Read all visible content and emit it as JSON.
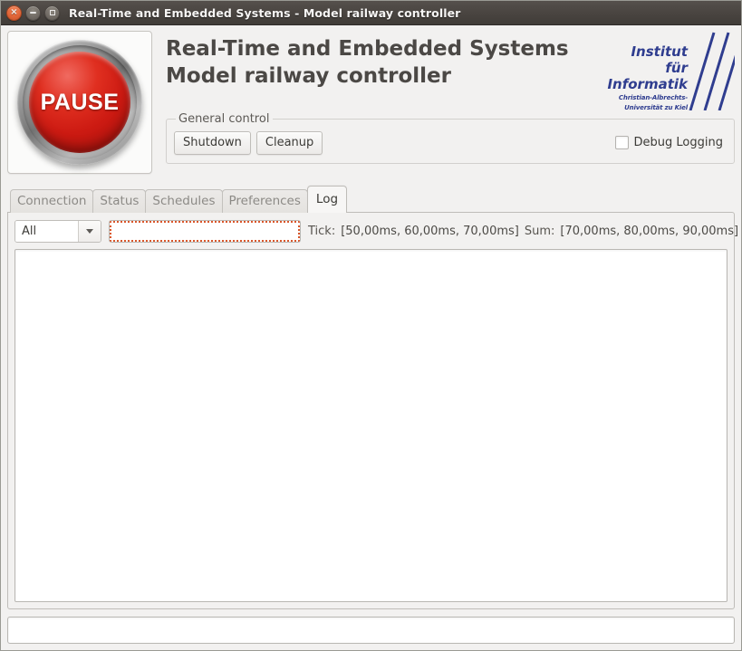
{
  "window": {
    "title": "Real-Time and Embedded Systems - Model railway controller",
    "buttons": {
      "close": "close-button",
      "minimize": "minimize-button",
      "maximize": "maximize-button",
      "close_glyph": "×"
    }
  },
  "header": {
    "pause_button_label": "PAUSE",
    "app_title_line1": "Real-Time and Embedded Systems",
    "app_title_line2": "Model railway controller",
    "logo": {
      "line1": "Institut",
      "line2": "für Informatik",
      "line3": "Christian-Albrechts-Universität zu Kiel",
      "color": "#2f3d8f"
    }
  },
  "general_control": {
    "legend": "General control",
    "shutdown_label": "Shutdown",
    "cleanup_label": "Cleanup",
    "debug_logging_label": "Debug Logging",
    "debug_logging_checked": false
  },
  "tabs": [
    {
      "label": "Connection",
      "active": false
    },
    {
      "label": "Status",
      "active": false
    },
    {
      "label": "Schedules",
      "active": false
    },
    {
      "label": "Preferences",
      "active": false
    },
    {
      "label": "Log",
      "active": true
    }
  ],
  "log_tab": {
    "filter_combo_value": "All",
    "search_value": "",
    "search_placeholder": "",
    "tick_label": "Tick:",
    "tick_value": "[50,00ms, 60,00ms, 70,00ms]",
    "sum_label": "Sum:",
    "sum_value": "[70,00ms, 80,00ms, 90,00ms]",
    "log_content": "",
    "status_field_value": ""
  }
}
